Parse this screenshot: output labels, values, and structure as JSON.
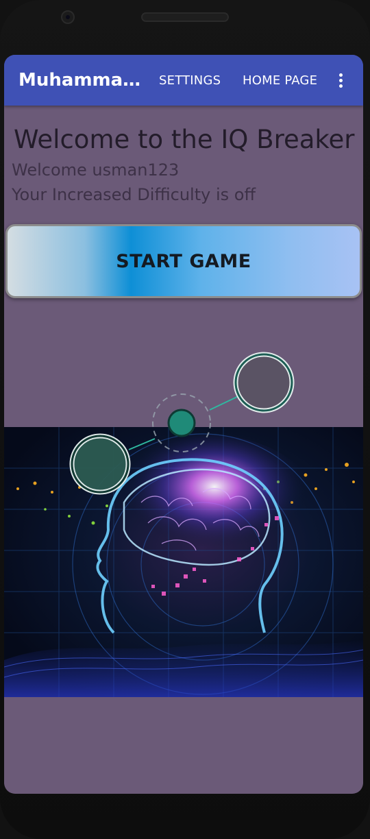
{
  "appbar": {
    "title": "Muhammad_...",
    "settings_label": "SETTINGS",
    "home_label": "HOME PAGE"
  },
  "main": {
    "heading": "Welcome to the IQ Breaker",
    "welcome_user": "Welcome usman123",
    "difficulty_status": "Your Increased Difficulty is off",
    "start_button_label": "START GAME"
  },
  "colors": {
    "appbar": "#3f51b5",
    "screen_background": "#6b5a78"
  },
  "icons": {
    "overflow": "more-vertical-icon"
  }
}
